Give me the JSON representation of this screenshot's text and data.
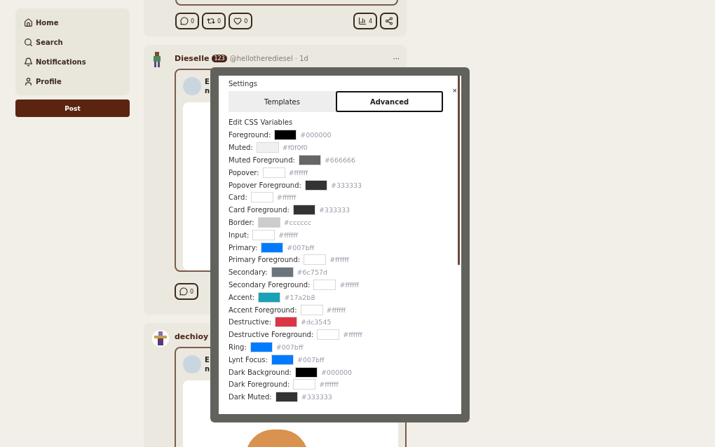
{
  "sidebar": {
    "items": [
      {
        "kind": "home",
        "label": "Home"
      },
      {
        "kind": "search",
        "label": "Search"
      },
      {
        "kind": "bell",
        "label": "Notifications"
      },
      {
        "kind": "user",
        "label": "Profile"
      }
    ],
    "post_button": "Post"
  },
  "feed": {
    "top_post_actions": [
      {
        "kind": "comment",
        "count": "0"
      },
      {
        "kind": "repost",
        "count": "0"
      },
      {
        "kind": "like",
        "count": "0"
      }
    ],
    "top_post_views": "4",
    "posts": [
      {
        "name": "Dieselle",
        "badge": "123",
        "handle": "@hellotherediesel · 1d",
        "menu": "···",
        "quote_initial": "E",
        "quote_line": "n",
        "kind": "pixel",
        "actions": [
          {
            "kind": "comment",
            "count": "0"
          }
        ]
      },
      {
        "name": "dechioy",
        "quote_initial": "E",
        "quote_line": "n",
        "kind": "round",
        "photo": true
      }
    ]
  },
  "settings": {
    "title": "Settings",
    "close": "×",
    "tabs": [
      {
        "label": "Templates",
        "selected": false
      },
      {
        "label": "Advanced",
        "selected": true
      }
    ],
    "section": "Edit CSS Variables",
    "variables": [
      {
        "label": "Foreground:",
        "color": "#000000",
        "value": "#000000"
      },
      {
        "label": "Muted:",
        "color": "#f0f0f0",
        "value": "#f0f0f0"
      },
      {
        "label": "Muted Foreground:",
        "color": "#666666",
        "value": "#666666"
      },
      {
        "label": "Popover:",
        "color": "#ffffff",
        "value": "#ffffff"
      },
      {
        "label": "Popover Foreground:",
        "color": "#333333",
        "value": "#333333"
      },
      {
        "label": "Card:",
        "color": "#ffffff",
        "value": "#ffffff"
      },
      {
        "label": "Card Foreground:",
        "color": "#333333",
        "value": "#333333"
      },
      {
        "label": "Border:",
        "color": "#cccccc",
        "value": "#cccccc"
      },
      {
        "label": "Input:",
        "color": "#ffffff",
        "value": "#ffffff"
      },
      {
        "label": "Primary:",
        "color": "#007bff",
        "value": "#007bff"
      },
      {
        "label": "Primary Foreground:",
        "color": "#ffffff",
        "value": "#ffffff"
      },
      {
        "label": "Secondary:",
        "color": "#6c757d",
        "value": "#6c757d"
      },
      {
        "label": "Secondary Foreground:",
        "color": "#ffffff",
        "value": "#ffffff"
      },
      {
        "label": "Accent:",
        "color": "#17a2b8",
        "value": "#17a2b8"
      },
      {
        "label": "Accent Foreground:",
        "color": "#ffffff",
        "value": "#ffffff"
      },
      {
        "label": "Destructive:",
        "color": "#dc3545",
        "value": "#dc3545"
      },
      {
        "label": "Destructive Foreground:",
        "color": "#ffffff",
        "value": "#ffffff"
      },
      {
        "label": "Ring:",
        "color": "#007bff",
        "value": "#007bff"
      },
      {
        "label": "Lynt Focus:",
        "color": "#007bff",
        "value": "#007bff"
      },
      {
        "label": "Dark Background:",
        "color": "#000000",
        "value": "#000000"
      },
      {
        "label": "Dark Foreground:",
        "color": "#ffffff",
        "value": "#ffffff"
      },
      {
        "label": "Dark Muted:",
        "color": "#333333",
        "value": "#333333"
      }
    ]
  }
}
